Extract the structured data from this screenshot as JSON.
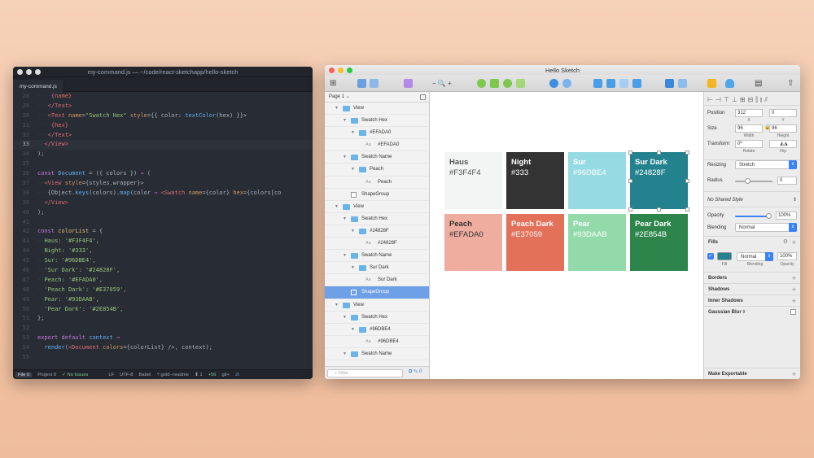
{
  "editor": {
    "title": "my-command.js — ~/code/react-sketchapp/hello-sketch",
    "tab": "my-command.js",
    "status": {
      "file": "File 0",
      "project": "Project 0",
      "issues": "✓ No Issues",
      "line_ending": "LF",
      "encoding": "UTF-8",
      "grammar": "Babel",
      "branch": "gold--readme",
      "push": "⬆ 1",
      "changes": "+56",
      "git": "git+",
      "count": "2t"
    }
  },
  "sketch": {
    "title": "Hello Sketch",
    "page": "Page 1",
    "filter_placeholder": "Filter",
    "zoom": "− 🔍 +",
    "layers": [
      {
        "name": "View",
        "type": "folder",
        "level": 0,
        "selected": false
      },
      {
        "name": "Swatch Hex",
        "type": "folder",
        "level": 1,
        "selected": false
      },
      {
        "name": "#EFADA0",
        "type": "folder",
        "level": 2,
        "selected": false
      },
      {
        "name": "#EFADA0",
        "type": "text",
        "level": 3,
        "selected": false
      },
      {
        "name": "Swatch Name",
        "type": "folder",
        "level": 1,
        "selected": false
      },
      {
        "name": "Peach",
        "type": "folder",
        "level": 2,
        "selected": false
      },
      {
        "name": "Peach",
        "type": "text",
        "level": 3,
        "selected": false
      },
      {
        "name": "ShapeGroup",
        "type": "shape",
        "level": 1,
        "selected": false
      },
      {
        "name": "View",
        "type": "folder",
        "level": 0,
        "selected": false
      },
      {
        "name": "Swatch Hex",
        "type": "folder",
        "level": 1,
        "selected": false
      },
      {
        "name": "#24828F",
        "type": "folder",
        "level": 2,
        "selected": false
      },
      {
        "name": "#24828F",
        "type": "text",
        "level": 3,
        "selected": false
      },
      {
        "name": "Swatch Name",
        "type": "folder",
        "level": 1,
        "selected": false
      },
      {
        "name": "Sur Dark",
        "type": "folder",
        "level": 2,
        "selected": false
      },
      {
        "name": "Sur Dark",
        "type": "text",
        "level": 3,
        "selected": false
      },
      {
        "name": "ShapeGroup",
        "type": "shape",
        "level": 1,
        "selected": true
      },
      {
        "name": "View",
        "type": "folder",
        "level": 0,
        "selected": false
      },
      {
        "name": "Swatch Hex",
        "type": "folder",
        "level": 1,
        "selected": false
      },
      {
        "name": "#96DBE4",
        "type": "folder",
        "level": 2,
        "selected": false
      },
      {
        "name": "#96DBE4",
        "type": "text",
        "level": 3,
        "selected": false
      },
      {
        "name": "Swatch Name",
        "type": "folder",
        "level": 1,
        "selected": false
      }
    ],
    "swatches": [
      {
        "name": "Haus",
        "hex": "#F3F4F4",
        "color": "#F3F4F4",
        "text": "#555555"
      },
      {
        "name": "Night",
        "hex": "#333",
        "color": "#333333",
        "text": "#ffffff"
      },
      {
        "name": "Sur",
        "hex": "#96DBE4",
        "color": "#96DBE4",
        "text": "#ffffff"
      },
      {
        "name": "Sur Dark",
        "hex": "#24828F",
        "color": "#24828F",
        "text": "#ffffff"
      },
      {
        "name": "Peach",
        "hex": "#EFADA0",
        "color": "#EFADA0",
        "text": "#333333"
      },
      {
        "name": "Peach Dark",
        "hex": "#E37059",
        "color": "#E37059",
        "text": "#ffffff"
      },
      {
        "name": "Pear",
        "hex": "#93DAAB",
        "color": "#93DAAB",
        "text": "#ffffff"
      },
      {
        "name": "Pear Dark",
        "hex": "#2E854B",
        "color": "#2E854B",
        "text": "#ffffff"
      }
    ],
    "inspector": {
      "position_label": "Position",
      "pos_x": "312",
      "pos_y": "0",
      "x_label": "X",
      "y_label": "Y",
      "size_label": "Size",
      "width": "96",
      "height": "96",
      "width_label": "Width",
      "height_label": "Height",
      "transform_label": "Transform",
      "rotate": "0º",
      "rotate_label": "Rotate",
      "flip_label": "Flip",
      "resizing_label": "Resizing",
      "resizing_value": "Stretch",
      "radius_label": "Radius",
      "radius_value": "0",
      "shared_style": "No Shared Style",
      "opacity_label": "Opacity",
      "opacity_value": "100%",
      "blending_label": "Blending",
      "blending_value": "Normal",
      "fills_label": "Fills",
      "fill_color": "#24828F",
      "fill_blend": "Normal",
      "fill_opacity": "100%",
      "fill_label": "Fill",
      "fill_blending_label": "Blending",
      "fill_opacity_label": "Opacity",
      "borders_label": "Borders",
      "shadows_label": "Shadows",
      "inner_shadows_label": "Inner Shadows",
      "blur_label": "Gaussian Blur ◊",
      "exportable_label": "Make Exportable"
    }
  },
  "code_lines": [
    {
      "n": "28",
      "parts": [
        [
          "d",
          "····"
        ],
        [
          "t",
          "{name}"
        ]
      ]
    },
    {
      "n": "29",
      "parts": [
        [
          "d",
          "···"
        ],
        [
          "t",
          "</Text>"
        ]
      ]
    },
    {
      "n": "30",
      "parts": [
        [
          "d",
          "···"
        ],
        [
          "t",
          "<Text "
        ],
        [
          "a",
          "name"
        ],
        [
          "",
          "="
        ],
        [
          "s",
          "\"Swatch Hex\" "
        ],
        [
          "a",
          "style"
        ],
        [
          "",
          "={{ color: "
        ],
        [
          "f",
          "textColor"
        ],
        [
          "",
          "(hex) }}>"
        ]
      ]
    },
    {
      "n": "31",
      "parts": [
        [
          "d",
          "····"
        ],
        [
          "t",
          "{hex}"
        ]
      ]
    },
    {
      "n": "32",
      "parts": [
        [
          "d",
          "···"
        ],
        [
          "t",
          "</Text>"
        ]
      ]
    },
    {
      "n": "33",
      "parts": [
        [
          "d",
          "··"
        ],
        [
          "t",
          "</View>"
        ]
      ],
      "cur": true
    },
    {
      "n": "34",
      "parts": [
        [
          "",
          ");"
        ]
      ]
    },
    {
      "n": "35",
      "parts": [
        [
          "",
          ""
        ]
      ]
    },
    {
      "n": "36",
      "parts": [
        [
          "k",
          "const "
        ],
        [
          "f",
          "Document"
        ],
        [
          "",
          " = ({ colors }) "
        ],
        [
          "k",
          "⇒ "
        ],
        [
          "",
          "("
        ]
      ]
    },
    {
      "n": "37",
      "parts": [
        [
          "d",
          "··"
        ],
        [
          "t",
          "<View "
        ],
        [
          "a",
          "style"
        ],
        [
          "",
          "={styles.wrapper}>"
        ]
      ]
    },
    {
      "n": "38",
      "parts": [
        [
          "d",
          "···"
        ],
        [
          "",
          "{Object."
        ],
        [
          "f",
          "keys"
        ],
        [
          "",
          "(colors)."
        ],
        [
          "f",
          "map"
        ],
        [
          "",
          "(color "
        ],
        [
          "k",
          "⇒ "
        ],
        [
          "t",
          "<Swatch "
        ],
        [
          "a",
          "name"
        ],
        [
          "",
          "={color} "
        ],
        [
          "a",
          "hex"
        ],
        [
          "",
          "={colors[co"
        ]
      ]
    },
    {
      "n": "39",
      "parts": [
        [
          "d",
          "··"
        ],
        [
          "t",
          "</View>"
        ]
      ]
    },
    {
      "n": "40",
      "parts": [
        [
          "",
          ");"
        ]
      ]
    },
    {
      "n": "41",
      "parts": [
        [
          "",
          ""
        ]
      ]
    },
    {
      "n": "42",
      "parts": [
        [
          "k",
          "const "
        ],
        [
          "v",
          "colorList"
        ],
        [
          "",
          " = {"
        ]
      ]
    },
    {
      "n": "43",
      "parts": [
        [
          "d",
          "··"
        ],
        [
          "s",
          "Haus: '#F3F4F4',"
        ]
      ]
    },
    {
      "n": "44",
      "parts": [
        [
          "d",
          "··"
        ],
        [
          "s",
          "Night: '#333',"
        ]
      ]
    },
    {
      "n": "45",
      "parts": [
        [
          "d",
          "··"
        ],
        [
          "s",
          "Sur: '#96DBE4',"
        ]
      ]
    },
    {
      "n": "46",
      "parts": [
        [
          "d",
          "··"
        ],
        [
          "s",
          "'Sur Dark': '#24828F',"
        ]
      ]
    },
    {
      "n": "47",
      "parts": [
        [
          "d",
          "··"
        ],
        [
          "s",
          "Peach: '#EFADA0',"
        ]
      ]
    },
    {
      "n": "48",
      "parts": [
        [
          "d",
          "··"
        ],
        [
          "s",
          "'Peach Dark': '#E37059',"
        ]
      ]
    },
    {
      "n": "49",
      "parts": [
        [
          "d",
          "··"
        ],
        [
          "s",
          "Pear: '#93DAAB',"
        ]
      ]
    },
    {
      "n": "50",
      "parts": [
        [
          "d",
          "··"
        ],
        [
          "s",
          "'Pear Dark': '#2E854B',"
        ]
      ]
    },
    {
      "n": "51",
      "parts": [
        [
          "",
          "};"
        ]
      ]
    },
    {
      "n": "52",
      "parts": [
        [
          "",
          ""
        ]
      ]
    },
    {
      "n": "53",
      "parts": [
        [
          "k",
          "export default "
        ],
        [
          "f",
          "context "
        ],
        [
          "k",
          "⇒"
        ]
      ]
    },
    {
      "n": "54",
      "parts": [
        [
          "d",
          "··"
        ],
        [
          "f",
          "render"
        ],
        [
          "",
          "("
        ],
        [
          "t",
          "<Document "
        ],
        [
          "a",
          "colors"
        ],
        [
          "",
          "={colorList} />, context);"
        ]
      ]
    },
    {
      "n": "55",
      "parts": [
        [
          "",
          ""
        ]
      ]
    }
  ]
}
